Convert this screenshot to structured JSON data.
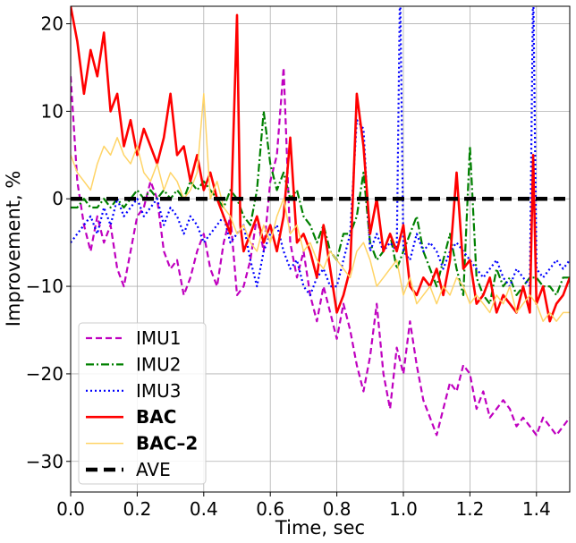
{
  "chart_data": {
    "type": "line",
    "title": "",
    "xlabel": "Time, sec",
    "ylabel": "Improvement, %",
    "xlim": [
      0,
      1.5
    ],
    "ylim": [
      -33.5,
      22
    ],
    "xticks": [
      0.0,
      0.2,
      0.4,
      0.6,
      0.8,
      1.0,
      1.2,
      1.4
    ],
    "xtick_labels": [
      "0.0",
      "0.2",
      "0.4",
      "0.6",
      "0.8",
      "1.0",
      "1.2",
      "1.4"
    ],
    "yticks": [
      -30,
      -20,
      -10,
      0,
      10,
      20
    ],
    "ytick_labels": [
      "−30",
      "−20",
      "−10",
      "0",
      "10",
      "20"
    ],
    "grid": true,
    "legend_position": "bottom-left",
    "series": [
      {
        "name": "IMU1",
        "color": "#bf00bf",
        "style": "dashed",
        "bold": false,
        "x": [
          0.0,
          0.02,
          0.04,
          0.06,
          0.08,
          0.1,
          0.12,
          0.14,
          0.16,
          0.18,
          0.2,
          0.22,
          0.24,
          0.26,
          0.28,
          0.3,
          0.32,
          0.34,
          0.36,
          0.38,
          0.4,
          0.42,
          0.44,
          0.46,
          0.48,
          0.5,
          0.52,
          0.54,
          0.56,
          0.58,
          0.6,
          0.62,
          0.64,
          0.66,
          0.68,
          0.7,
          0.72,
          0.74,
          0.76,
          0.78,
          0.8,
          0.82,
          0.84,
          0.86,
          0.88,
          0.9,
          0.92,
          0.94,
          0.96,
          0.98,
          1.0,
          1.02,
          1.04,
          1.06,
          1.08,
          1.1,
          1.12,
          1.14,
          1.16,
          1.18,
          1.2,
          1.22,
          1.24,
          1.26,
          1.28,
          1.3,
          1.32,
          1.34,
          1.36,
          1.38,
          1.4,
          1.42,
          1.44,
          1.46,
          1.48,
          1.5
        ],
        "y": [
          14,
          2,
          -3,
          -6,
          -2,
          -5,
          -3,
          -8,
          -10,
          -6,
          -2,
          -1,
          2,
          0,
          -6,
          -8,
          -7,
          -11,
          -9,
          -6,
          -4,
          -8,
          -10,
          -5,
          -2,
          -11,
          -10,
          -7,
          -2,
          -6,
          2,
          5,
          15,
          -5,
          -9,
          -6,
          -11,
          -14,
          -10,
          -13,
          -16,
          -12,
          -15,
          -19,
          -22,
          -18,
          -12,
          -20,
          -24,
          -17,
          -20,
          -14,
          -19,
          -23,
          -25,
          -27,
          -24,
          -21,
          -22,
          -19,
          -20,
          -24,
          -22,
          -25,
          -24,
          -23,
          -24,
          -26,
          -25,
          -26,
          -27,
          -25,
          -26,
          -27,
          -26,
          -25
        ]
      },
      {
        "name": "IMU2",
        "color": "#008000",
        "style": "dashdot",
        "bold": false,
        "x": [
          0.0,
          0.02,
          0.04,
          0.06,
          0.08,
          0.1,
          0.12,
          0.14,
          0.16,
          0.18,
          0.2,
          0.22,
          0.24,
          0.26,
          0.28,
          0.3,
          0.32,
          0.34,
          0.36,
          0.38,
          0.4,
          0.42,
          0.44,
          0.46,
          0.48,
          0.5,
          0.52,
          0.54,
          0.56,
          0.58,
          0.6,
          0.62,
          0.64,
          0.66,
          0.68,
          0.7,
          0.72,
          0.74,
          0.76,
          0.78,
          0.8,
          0.82,
          0.84,
          0.86,
          0.88,
          0.9,
          0.92,
          0.94,
          0.96,
          0.98,
          1.0,
          1.02,
          1.04,
          1.06,
          1.08,
          1.1,
          1.12,
          1.14,
          1.16,
          1.18,
          1.2,
          1.22,
          1.24,
          1.26,
          1.28,
          1.3,
          1.32,
          1.34,
          1.36,
          1.38,
          1.4,
          1.42,
          1.44,
          1.46,
          1.48,
          1.5
        ],
        "y": [
          -1,
          -1,
          0,
          -1,
          -1,
          0,
          -1,
          0,
          -1,
          0,
          1,
          0,
          1,
          0,
          1,
          0,
          1,
          0,
          2,
          1,
          2,
          1,
          0,
          -1,
          1,
          0,
          -2,
          -3,
          1,
          10,
          4,
          1,
          3,
          0,
          1,
          -2,
          -3,
          -5,
          -3,
          -6,
          -7,
          -4,
          -4,
          -2,
          3,
          -5,
          -7,
          -6,
          -4,
          -8,
          -6,
          -4,
          -2,
          -6,
          -8,
          -10,
          -7,
          -4,
          -8,
          -11,
          6,
          -9,
          -11,
          -12,
          -8,
          -10,
          -9,
          -11,
          -10,
          -9,
          -9,
          -10,
          -10,
          -11,
          -9,
          -9
        ]
      },
      {
        "name": "IMU3",
        "color": "#0000ff",
        "style": "dotted",
        "bold": false,
        "x": [
          0.0,
          0.02,
          0.04,
          0.06,
          0.08,
          0.1,
          0.12,
          0.14,
          0.16,
          0.18,
          0.2,
          0.22,
          0.24,
          0.26,
          0.28,
          0.3,
          0.32,
          0.34,
          0.36,
          0.38,
          0.4,
          0.42,
          0.44,
          0.46,
          0.48,
          0.5,
          0.52,
          0.54,
          0.56,
          0.58,
          0.6,
          0.62,
          0.64,
          0.66,
          0.68,
          0.7,
          0.72,
          0.74,
          0.76,
          0.78,
          0.8,
          0.82,
          0.84,
          0.86,
          0.88,
          0.9,
          0.92,
          0.94,
          0.96,
          0.98,
          0.99,
          1.0,
          1.02,
          1.04,
          1.06,
          1.08,
          1.1,
          1.12,
          1.14,
          1.16,
          1.18,
          1.2,
          1.22,
          1.24,
          1.26,
          1.28,
          1.3,
          1.32,
          1.34,
          1.36,
          1.38,
          1.39,
          1.4,
          1.42,
          1.44,
          1.46,
          1.48,
          1.5
        ],
        "y": [
          -5,
          -4,
          -3,
          -2,
          -4,
          -1,
          -3,
          0,
          -2,
          -1,
          0,
          -2,
          -1,
          0,
          -3,
          -1,
          -2,
          -4,
          -2,
          -3,
          -5,
          -4,
          -3,
          -2,
          -5,
          -4,
          -3,
          -7,
          -10,
          -6,
          -4,
          -3,
          -6,
          -8,
          -7,
          -10,
          -11,
          -9,
          -8,
          -10,
          -10,
          -7,
          -4,
          9,
          8,
          -6,
          -4,
          -6,
          -5,
          -6,
          25,
          -6,
          -7,
          -4,
          -6,
          -5,
          -6,
          -8,
          -6,
          -5,
          -6,
          -7,
          -8,
          -9,
          -8,
          -7,
          -9,
          -10,
          -8,
          -9,
          -10,
          25,
          -8,
          -9,
          -8,
          -7,
          -8,
          -7
        ]
      },
      {
        "name": "BAC",
        "color": "#ff0000",
        "style": "solid",
        "bold": true,
        "x": [
          0.0,
          0.02,
          0.04,
          0.06,
          0.08,
          0.1,
          0.12,
          0.14,
          0.16,
          0.18,
          0.2,
          0.22,
          0.24,
          0.26,
          0.28,
          0.3,
          0.32,
          0.34,
          0.36,
          0.38,
          0.4,
          0.42,
          0.44,
          0.46,
          0.48,
          0.5,
          0.51,
          0.52,
          0.54,
          0.56,
          0.58,
          0.6,
          0.62,
          0.64,
          0.66,
          0.68,
          0.7,
          0.72,
          0.74,
          0.76,
          0.78,
          0.8,
          0.82,
          0.84,
          0.86,
          0.88,
          0.9,
          0.92,
          0.94,
          0.96,
          0.98,
          1.0,
          1.02,
          1.04,
          1.06,
          1.08,
          1.1,
          1.12,
          1.14,
          1.16,
          1.18,
          1.2,
          1.22,
          1.24,
          1.26,
          1.28,
          1.3,
          1.32,
          1.34,
          1.36,
          1.38,
          1.39,
          1.4,
          1.42,
          1.44,
          1.46,
          1.48,
          1.5
        ],
        "y": [
          22,
          18,
          12,
          17,
          14,
          19,
          10,
          12,
          6,
          9,
          5,
          8,
          6,
          4,
          7,
          12,
          5,
          6,
          2,
          5,
          1,
          3,
          0,
          -2,
          -4,
          21,
          -3,
          -6,
          -4,
          -2,
          -5,
          -3,
          -6,
          -2,
          7,
          -5,
          -4,
          -6,
          -9,
          -3,
          -8,
          -13,
          -11,
          -8,
          12,
          6,
          -4,
          0,
          -6,
          -4,
          -6,
          -3,
          -10,
          -11,
          -9,
          -10,
          -8,
          -11,
          -7,
          3,
          -8,
          -7,
          -12,
          -11,
          -9,
          -13,
          -11,
          -12,
          -13,
          -10,
          -13,
          5,
          -12,
          -10,
          -14,
          -12,
          -11,
          -9
        ]
      },
      {
        "name": "BAC–2",
        "color": "#ffd466",
        "style": "solid",
        "bold": true,
        "x": [
          0.0,
          0.02,
          0.04,
          0.06,
          0.08,
          0.1,
          0.12,
          0.14,
          0.16,
          0.18,
          0.2,
          0.22,
          0.24,
          0.26,
          0.28,
          0.3,
          0.32,
          0.34,
          0.36,
          0.38,
          0.4,
          0.42,
          0.44,
          0.46,
          0.48,
          0.5,
          0.52,
          0.54,
          0.56,
          0.58,
          0.6,
          0.62,
          0.64,
          0.66,
          0.68,
          0.7,
          0.72,
          0.74,
          0.76,
          0.78,
          0.8,
          0.82,
          0.84,
          0.86,
          0.88,
          0.9,
          0.92,
          0.94,
          0.96,
          0.98,
          1.0,
          1.02,
          1.04,
          1.06,
          1.08,
          1.1,
          1.12,
          1.14,
          1.16,
          1.18,
          1.2,
          1.22,
          1.24,
          1.26,
          1.28,
          1.3,
          1.32,
          1.34,
          1.36,
          1.38,
          1.4,
          1.42,
          1.44,
          1.46,
          1.48,
          1.5
        ],
        "y": [
          5,
          3,
          2,
          1,
          4,
          6,
          5,
          7,
          5,
          4,
          6,
          3,
          2,
          4,
          1,
          3,
          2,
          0,
          1,
          3,
          12,
          0,
          2,
          -1,
          -2,
          -4,
          -3,
          -5,
          -6,
          -3,
          -5,
          -2,
          0,
          -4,
          -3,
          -6,
          -5,
          -7,
          -8,
          -6,
          -7,
          -8,
          -9,
          -6,
          -5,
          -7,
          -10,
          -9,
          -8,
          -7,
          -11,
          -9,
          -12,
          -11,
          -10,
          -12,
          -10,
          -11,
          -9,
          -10,
          -12,
          -11,
          -12,
          -13,
          -11,
          -12,
          -10,
          -13,
          -12,
          -11,
          -12,
          -14,
          -13,
          -14,
          -13,
          -13
        ]
      },
      {
        "name": "AVE",
        "color": "#000000",
        "style": "thick-dashed",
        "bold": false,
        "x": [
          0.0,
          1.5
        ],
        "y": [
          0,
          0
        ]
      }
    ]
  }
}
